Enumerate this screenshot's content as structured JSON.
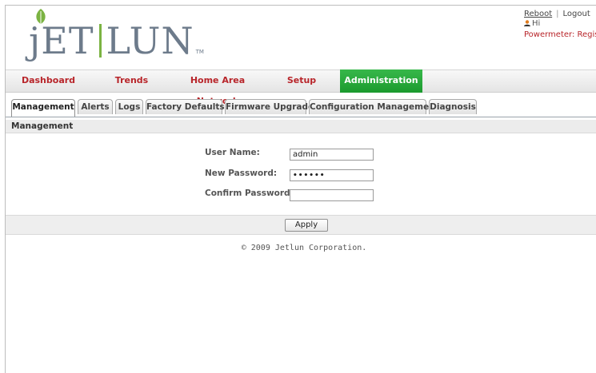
{
  "brand": {
    "logo_text": "JET LUN",
    "tm": "TM"
  },
  "topright": {
    "reboot_label": "Reboot",
    "logout_label": "Logout",
    "separator": "|",
    "greeting": "Hi",
    "powermeter_text": "Powermeter: Registered"
  },
  "mainnav": {
    "items": [
      {
        "label": "Dashboard"
      },
      {
        "label": "Trends"
      },
      {
        "label": "Home Area Network"
      },
      {
        "label": "Setup"
      },
      {
        "label": "Administration",
        "active": true
      }
    ]
  },
  "subtabs": {
    "items": [
      {
        "label": "Management",
        "active": true
      },
      {
        "label": "Alerts"
      },
      {
        "label": "Logs"
      },
      {
        "label": "Factory Defaults"
      },
      {
        "label": "Firmware Upgrade"
      },
      {
        "label": "Configuration Management"
      },
      {
        "label": "Diagnosis"
      }
    ]
  },
  "section": {
    "title": "Management"
  },
  "form": {
    "username_label": "User Name:",
    "username_value": "admin",
    "new_password_label": "New Password:",
    "new_password_value": "••••••",
    "confirm_password_label": "Confirm Password:",
    "confirm_password_value": ""
  },
  "apply_label": "Apply",
  "footer": {
    "copyright": "© 2009 Jetlun Corporation."
  },
  "colors": {
    "nav_text": "#b8252a",
    "active_tab": "#2aa83d",
    "logo_bar": "#7bb342",
    "logo_text": "#6d7b8b"
  }
}
